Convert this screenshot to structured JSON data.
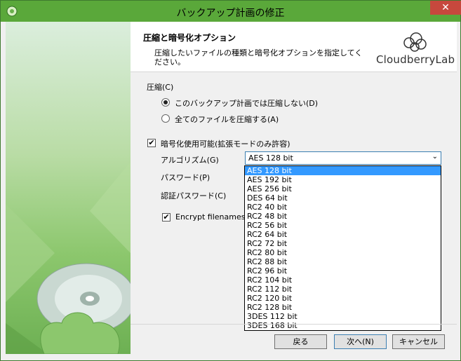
{
  "window": {
    "title": "バックアップ計画の修正",
    "close_label": "✕"
  },
  "header": {
    "title": "圧縮と暗号化オプション",
    "description": "圧縮したいファイルの種類と暗号化オプションを指定してください。",
    "logo_text": "CloudberryLab"
  },
  "compression": {
    "label": "圧縮(C)",
    "option_none": "このバックアップ計画では圧縮しない(D)",
    "option_all": "全てのファイルを圧縮する(A)"
  },
  "encryption": {
    "checkbox_label": "暗号化使用可能(拡張モードのみ許容)",
    "algorithm_label": "アルゴリズム(G)",
    "password_label": "パスワード(P)",
    "confirm_label": "認証パスワード(C)",
    "filenames_label": "Encrypt filenames",
    "selected": "AES 128 bit",
    "options": [
      "AES 128 bit",
      "AES 192 bit",
      "AES 256 bit",
      "DES 64 bit",
      "RC2 40 bit",
      "RC2 48 bit",
      "RC2 56 bit",
      "RC2 64 bit",
      "RC2 72 bit",
      "RC2 80 bit",
      "RC2 88 bit",
      "RC2 96 bit",
      "RC2 104 bit",
      "RC2 112 bit",
      "RC2 120 bit",
      "RC2 128 bit",
      "3DES 112 bit",
      "3DES 168 bit"
    ]
  },
  "buttons": {
    "back": "戻る",
    "next": "次へ(N)",
    "cancel": "キャンセル"
  }
}
